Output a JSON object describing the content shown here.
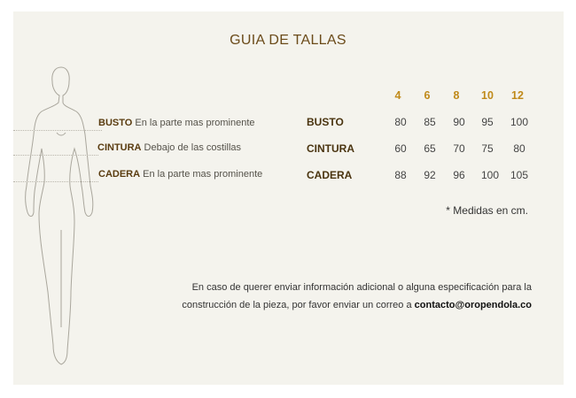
{
  "title": "GUIA DE TALLAS",
  "colors": {
    "title": "#6b4b1a",
    "accent": "#c08a1a",
    "card_bg": "#f4f3ed",
    "figure_stroke": "#a9a69c"
  },
  "measure_labels": [
    {
      "bold": "BUSTO",
      "text": " En la parte mas prominente"
    },
    {
      "bold": "CINTURA",
      "text": " Debajo de las costillas"
    },
    {
      "bold": "CADERA",
      "text": " En la parte mas prominente"
    }
  ],
  "table": {
    "sizes": [
      "4",
      "6",
      "8",
      "10",
      "12"
    ],
    "rows": [
      {
        "name": "BUSTO",
        "values": [
          "80",
          "85",
          "90",
          "95",
          "100"
        ]
      },
      {
        "name": "CINTURA",
        "values": [
          "60",
          "65",
          "70",
          "75",
          "80"
        ]
      },
      {
        "name": "CADERA",
        "values": [
          "88",
          "92",
          "96",
          "100",
          "105"
        ]
      }
    ]
  },
  "note": "* Medidas en cm.",
  "info": {
    "line1": "En caso de querer enviar información adicional o alguna especificación para la",
    "line2": "construcción de la pieza, por favor enviar un correo a ",
    "email": "contacto@oropendola.co"
  }
}
